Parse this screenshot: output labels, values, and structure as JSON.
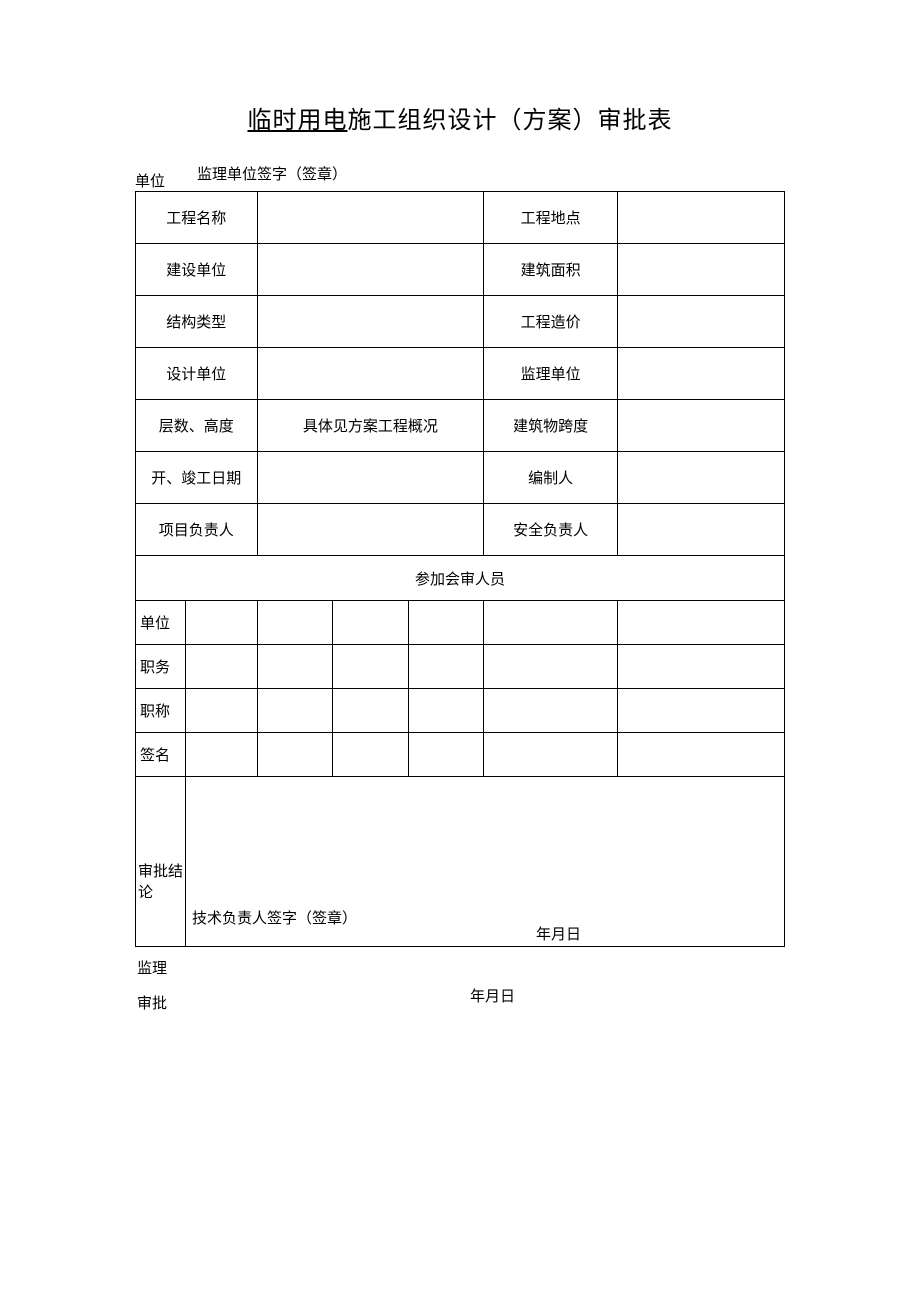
{
  "title_underlined": "临时用电",
  "title_rest": "施工组织设计（方案）审批表",
  "header": {
    "left": "单位",
    "right": "监理单位签字（签章）"
  },
  "info": [
    {
      "l1": "工程名称",
      "v1": "",
      "l2": "工程地点",
      "v2": ""
    },
    {
      "l1": "建设单位",
      "v1": "",
      "l2": "建筑面积",
      "v2": ""
    },
    {
      "l1": "结构类型",
      "v1": "",
      "l2": "工程造价",
      "v2": ""
    },
    {
      "l1": "设计单位",
      "v1": "",
      "l2": "监理单位",
      "v2": ""
    },
    {
      "l1": "层数、高度",
      "v1": "具体见方案工程概况",
      "l2": "建筑物跨度",
      "v2": ""
    },
    {
      "l1": "开、竣工日期",
      "v1": "",
      "l2": "编制人",
      "v2": ""
    },
    {
      "l1": "项目负责人",
      "v1": "",
      "l2": "安全负责人",
      "v2": ""
    }
  ],
  "review_header": "参加会审人员",
  "review_rows": [
    {
      "label": "单位",
      "c1": "",
      "c2": "",
      "c3": "",
      "c4": "",
      "c5": "",
      "c6": ""
    },
    {
      "label": "职务",
      "c1": "",
      "c2": "",
      "c3": "",
      "c4": "",
      "c5": "",
      "c6": ""
    },
    {
      "label": "职称",
      "c1": "",
      "c2": "",
      "c3": "",
      "c4": "",
      "c5": "",
      "c6": ""
    },
    {
      "label": "签名",
      "c1": "",
      "c2": "",
      "c3": "",
      "c4": "",
      "c5": "",
      "c6": ""
    }
  ],
  "conclusion": {
    "label": "审批结论",
    "tech_sign": "技术负责人签字（签章）",
    "date": "年月日"
  },
  "footer": {
    "line1": "监理",
    "line2": "审批",
    "date": "年月日"
  }
}
